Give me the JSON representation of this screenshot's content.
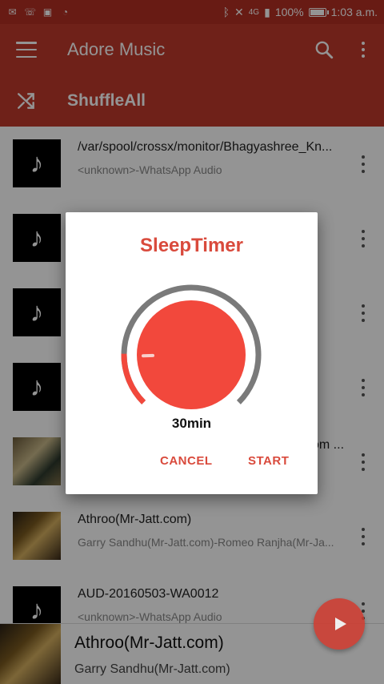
{
  "status_bar": {
    "battery": "100%",
    "time": "1:03 a.m.",
    "network": "4G"
  },
  "app_bar": {
    "title": "Adore Music",
    "shuffle_label": "ShuffleAll"
  },
  "songs": [
    {
      "title": "/var/spool/crossx/monitor/Bhagyashree_Kn...",
      "subtitle": "<unknown>-WhatsApp Audio"
    },
    {
      "title": "",
      "subtitle": ""
    },
    {
      "title": "",
      "subtitle": ""
    },
    {
      "title": "",
      "subtitle": ""
    },
    {
      "title": "om ...",
      "subtitle": ""
    },
    {
      "title": "Athroo(Mr-Jatt.com)",
      "subtitle": "Garry Sandhu(Mr-Jatt.com)-Romeo Ranjha(Mr-Ja..."
    },
    {
      "title": "AUD-20160503-WA0012",
      "subtitle": "<unknown>-WhatsApp Audio"
    }
  ],
  "now_playing": {
    "title": "Athroo(Mr-Jatt.com)",
    "artist": "Garry Sandhu(Mr-Jatt.com)"
  },
  "sleep_timer": {
    "title": "SleepTimer",
    "value": "30min",
    "cancel_label": "CANCEL",
    "start_label": "START",
    "level_fraction": 0.17
  },
  "colors": {
    "primary": "#c0392b",
    "accent": "#d94a3c",
    "dial": "#f2483c"
  }
}
